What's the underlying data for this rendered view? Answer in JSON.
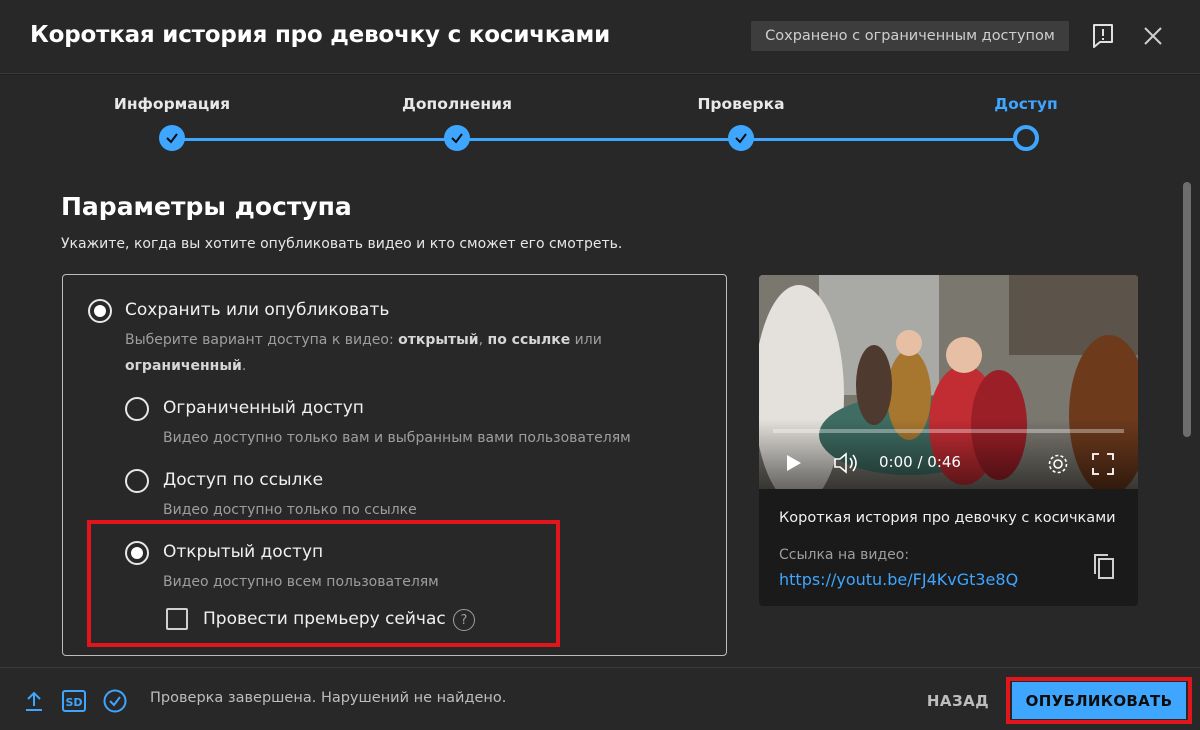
{
  "header": {
    "title": "Короткая история про девочку с косичками",
    "saved_status": "Сохранено с ограниченным доступом",
    "feedback_icon": "feedback-icon",
    "close_icon": "close-icon"
  },
  "stepper": {
    "steps": [
      {
        "label": "Информация",
        "state": "done"
      },
      {
        "label": "Дополнения",
        "state": "done"
      },
      {
        "label": "Проверка",
        "state": "done"
      },
      {
        "label": "Доступ",
        "state": "current"
      }
    ]
  },
  "section": {
    "title": "Параметры доступа",
    "description": "Укажите, когда вы хотите опубликовать видео и кто сможет его смотреть."
  },
  "options": {
    "save_publish": {
      "label": "Сохранить или опубликовать",
      "desc_prefix": "Выберите вариант доступа к видео: ",
      "opt_public": "открытый",
      "desc_sep": ", ",
      "opt_link": "по ссылке",
      "desc_or": " или",
      "opt_private": "ограниченный",
      "desc_end": ".",
      "checked": true
    },
    "private": {
      "label": "Ограниченный доступ",
      "desc": "Видео доступно только вам и выбранным вами пользователям",
      "checked": false
    },
    "unlisted": {
      "label": "Доступ по ссылке",
      "desc": "Видео доступно только по ссылке",
      "checked": false
    },
    "public": {
      "label": "Открытый доступ",
      "desc": "Видео доступно всем пользователям",
      "checked": true
    },
    "premiere": {
      "label": "Провести премьеру сейчас",
      "help": "?",
      "checked": false
    }
  },
  "video": {
    "time": "0:00 / 0:46",
    "progress": 0,
    "title": "Короткая история про девочку с косичками",
    "link_caption": "Ссылка на видео:",
    "link": "https://youtu.be/FJ4KvGt3e8Q"
  },
  "footer": {
    "status": "Проверка завершена. Нарушений не найдено.",
    "quality_badge": "SD",
    "back": "НАЗАД",
    "publish": "ОПУБЛИКОВАТЬ"
  },
  "colors": {
    "accent": "#3ea6ff",
    "highlight": "#e0161c",
    "background": "#282828"
  }
}
